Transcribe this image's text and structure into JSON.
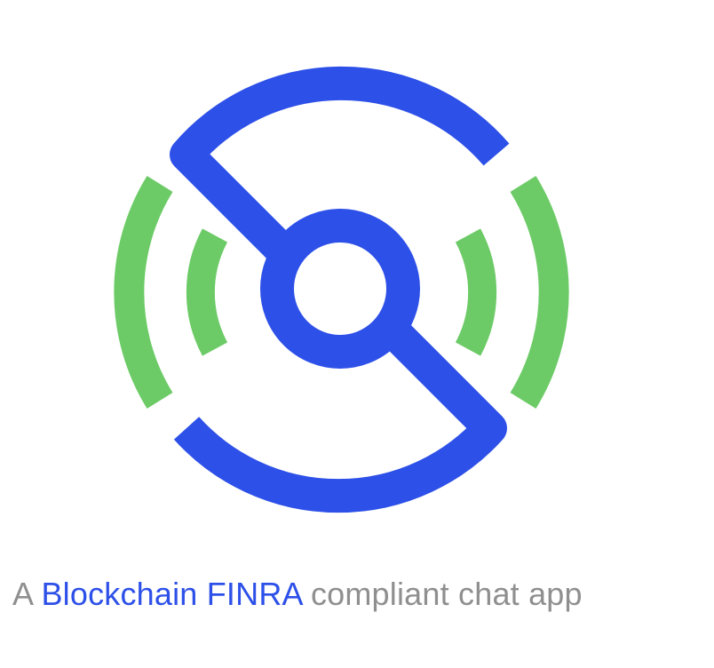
{
  "tagline": {
    "prefix": "A ",
    "highlight": "Blockchain FINRA",
    "suffix": " compliant chat app"
  },
  "colors": {
    "brand_blue": "#2d50e8",
    "brand_green": "#6ccb66",
    "text_gray": "#8f8f8f",
    "background": "#ffffff"
  },
  "logo": {
    "icon": "signal-chat-logo-icon"
  }
}
